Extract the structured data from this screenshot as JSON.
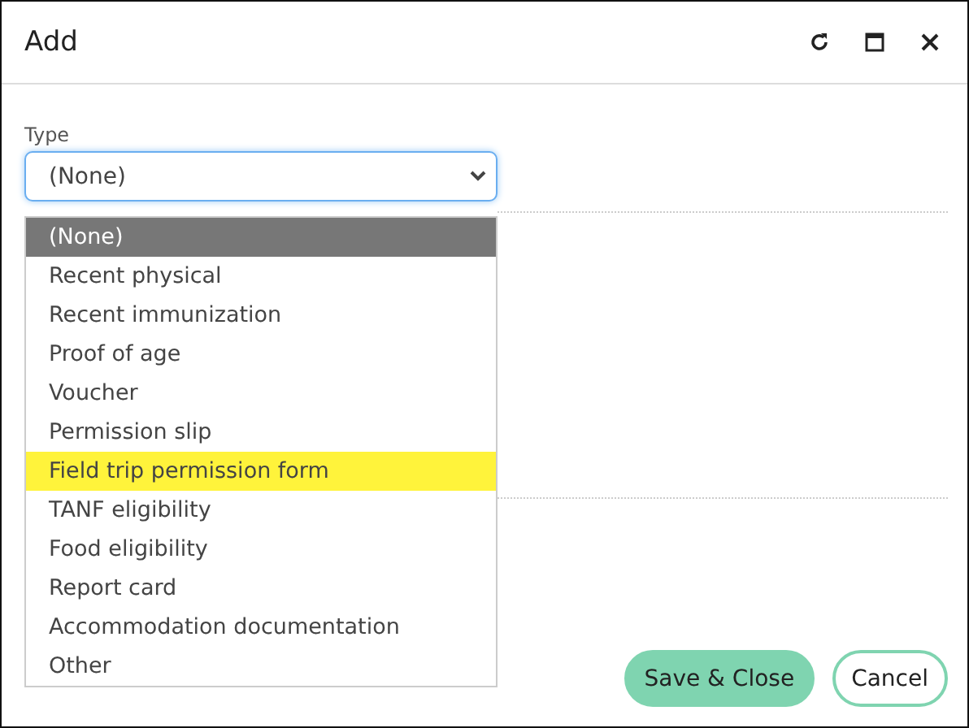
{
  "window": {
    "title": "Add"
  },
  "type_field": {
    "label": "Type",
    "value": "(None)",
    "expanded": true
  },
  "options": [
    {
      "label": "(None)",
      "selected": true,
      "highlighted": false
    },
    {
      "label": "Recent physical",
      "selected": false,
      "highlighted": false
    },
    {
      "label": "Recent immunization",
      "selected": false,
      "highlighted": false
    },
    {
      "label": "Proof of age",
      "selected": false,
      "highlighted": false
    },
    {
      "label": "Voucher",
      "selected": false,
      "highlighted": false
    },
    {
      "label": "Permission slip",
      "selected": false,
      "highlighted": false
    },
    {
      "label": "Field trip permission form",
      "selected": false,
      "highlighted": true
    },
    {
      "label": "TANF eligibility",
      "selected": false,
      "highlighted": false
    },
    {
      "label": "Food eligibility",
      "selected": false,
      "highlighted": false
    },
    {
      "label": "Report card",
      "selected": false,
      "highlighted": false
    },
    {
      "label": "Accommodation documentation",
      "selected": false,
      "highlighted": false
    },
    {
      "label": "Other",
      "selected": false,
      "highlighted": false
    }
  ],
  "buttons": [
    {
      "label": "Save & Close",
      "kind": "primary"
    },
    {
      "label": "Cancel",
      "kind": "secondary"
    }
  ]
}
